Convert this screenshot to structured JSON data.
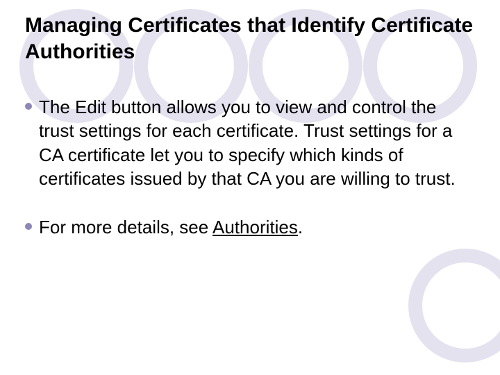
{
  "slide": {
    "title": "Managing Certificates that Identify Certificate Authorities",
    "bullets": [
      {
        "text": "The Edit button allows you to view and control the trust settings for each certificate. Trust settings for a CA certificate let you to specify which kinds of certificates issued by that CA you are willing to trust."
      },
      {
        "lead": "For more details, see ",
        "link": "Authorities",
        "trail": "."
      }
    ]
  },
  "style": {
    "circle_stroke": "#e4e2ef",
    "bullet_color": "#8d88b6"
  }
}
